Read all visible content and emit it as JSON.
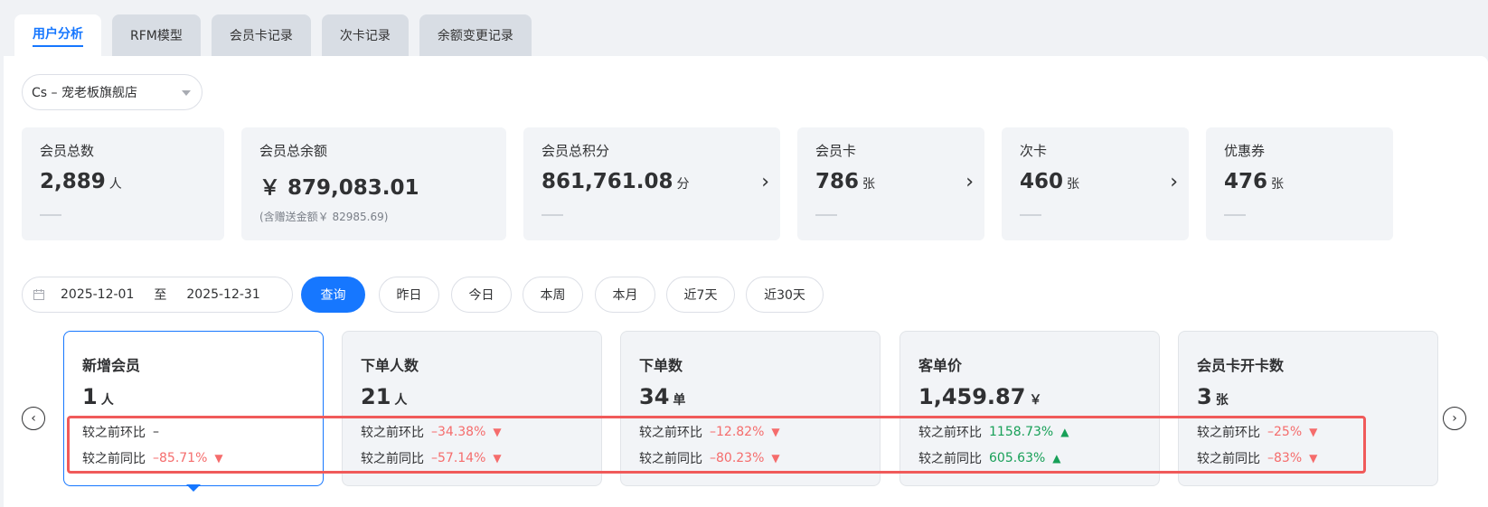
{
  "tabs": [
    {
      "label": "用户分析",
      "active": true
    },
    {
      "label": "RFM模型",
      "active": false
    },
    {
      "label": "会员卡记录",
      "active": false
    },
    {
      "label": "次卡记录",
      "active": false
    },
    {
      "label": "余额变更记录",
      "active": false
    }
  ],
  "store_select": {
    "value": "Cs – 宠老板旗舰店"
  },
  "stats": [
    {
      "label": "会员总数",
      "value": "2,889",
      "unit": "人"
    },
    {
      "label": "会员总余额",
      "value": "￥ 879,083.01",
      "unit": "",
      "note": "(含赠送金额￥ 82985.69)"
    },
    {
      "label": "会员总积分",
      "value": "861,761.08",
      "unit": "分"
    },
    {
      "label": "会员卡",
      "value": "786",
      "unit": "张"
    },
    {
      "label": "次卡",
      "value": "460",
      "unit": "张"
    },
    {
      "label": "优惠券",
      "value": "476",
      "unit": "张"
    }
  ],
  "date_range": {
    "start": "2025-12-01",
    "separator": "至",
    "end": "2025-12-31"
  },
  "query_label": "查询",
  "quick_ranges": [
    "昨日",
    "今日",
    "本周",
    "本月",
    "近7天",
    "近30天"
  ],
  "metrics": [
    {
      "title": "新增会员",
      "value": "1",
      "unit": "人",
      "mom_label": "较之前环比",
      "mom": "–",
      "mom_dir": "none",
      "yoy_label": "较之前同比",
      "yoy": "–85.71%",
      "yoy_dir": "down",
      "active": true
    },
    {
      "title": "下单人数",
      "value": "21",
      "unit": "人",
      "mom_label": "较之前环比",
      "mom": "–34.38%",
      "mom_dir": "down",
      "yoy_label": "较之前同比",
      "yoy": "–57.14%",
      "yoy_dir": "down",
      "active": false
    },
    {
      "title": "下单数",
      "value": "34",
      "unit": "单",
      "mom_label": "较之前环比",
      "mom": "–12.82%",
      "mom_dir": "down",
      "yoy_label": "较之前同比",
      "yoy": "–80.23%",
      "yoy_dir": "down",
      "active": false
    },
    {
      "title": "客单价",
      "value": "1,459.87",
      "unit": "￥",
      "mom_label": "较之前环比",
      "mom": "1158.73%",
      "mom_dir": "up",
      "yoy_label": "较之前同比",
      "yoy": "605.63%",
      "yoy_dir": "up",
      "active": false
    },
    {
      "title": "会员卡开卡数",
      "value": "3",
      "unit": "张",
      "mom_label": "较之前环比",
      "mom": "–25%",
      "mom_dir": "down",
      "yoy_label": "较之前同比",
      "yoy": "–83%",
      "yoy_dir": "down",
      "active": false
    }
  ],
  "icons": {
    "arrow_down": "▼",
    "arrow_up": "▲",
    "chevron_right": "›",
    "prev": "‹",
    "next": "›",
    "calendar": "calendar-icon"
  },
  "colors": {
    "accent": "#1677ff",
    "down": "#f56c6c",
    "up": "#18a058",
    "highlight": "#f05a5a"
  }
}
